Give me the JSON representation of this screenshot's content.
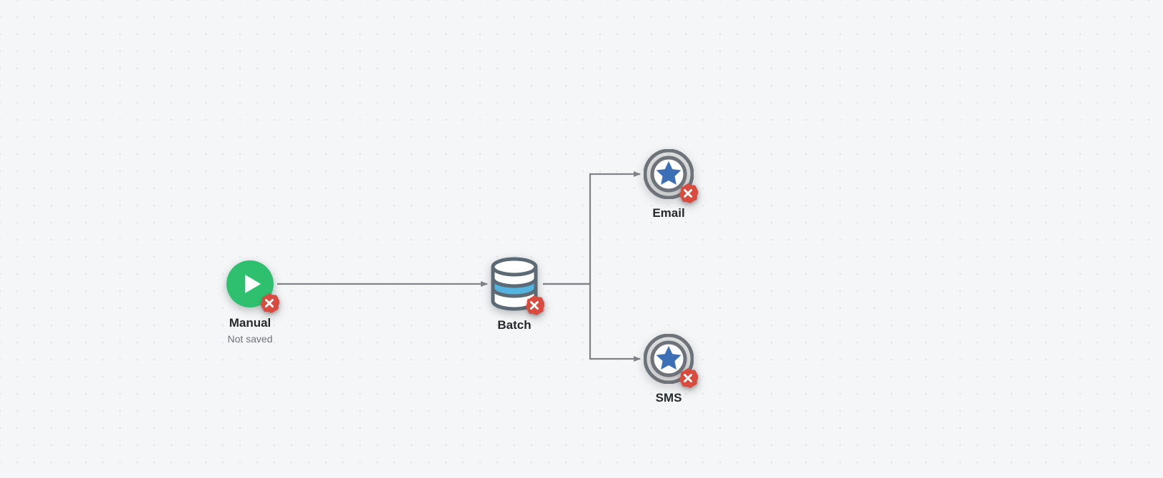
{
  "nodes": {
    "manual": {
      "title": "Manual",
      "subtitle": "Not saved",
      "icon": "play-icon",
      "error": true
    },
    "batch": {
      "title": "Batch",
      "icon": "database-icon",
      "error": true
    },
    "email": {
      "title": "Email",
      "icon": "star-badge-icon",
      "error": true
    },
    "sms": {
      "title": "SMS",
      "icon": "star-badge-icon",
      "error": true
    }
  },
  "connections": [
    {
      "from": "manual",
      "to": "batch"
    },
    {
      "from": "batch",
      "to": "email"
    },
    {
      "from": "batch",
      "to": "sms"
    }
  ],
  "colors": {
    "play_fill": "#2ec06f",
    "db_body": "#ffffff",
    "db_stroke": "#5b6a74",
    "db_band": "#52b4df",
    "star_outer": "#6d7378",
    "star_inner_fill": "#ffffff",
    "star_fill": "#3d6fb6",
    "error_fill": "#d94a3f",
    "connector": "#808488"
  }
}
